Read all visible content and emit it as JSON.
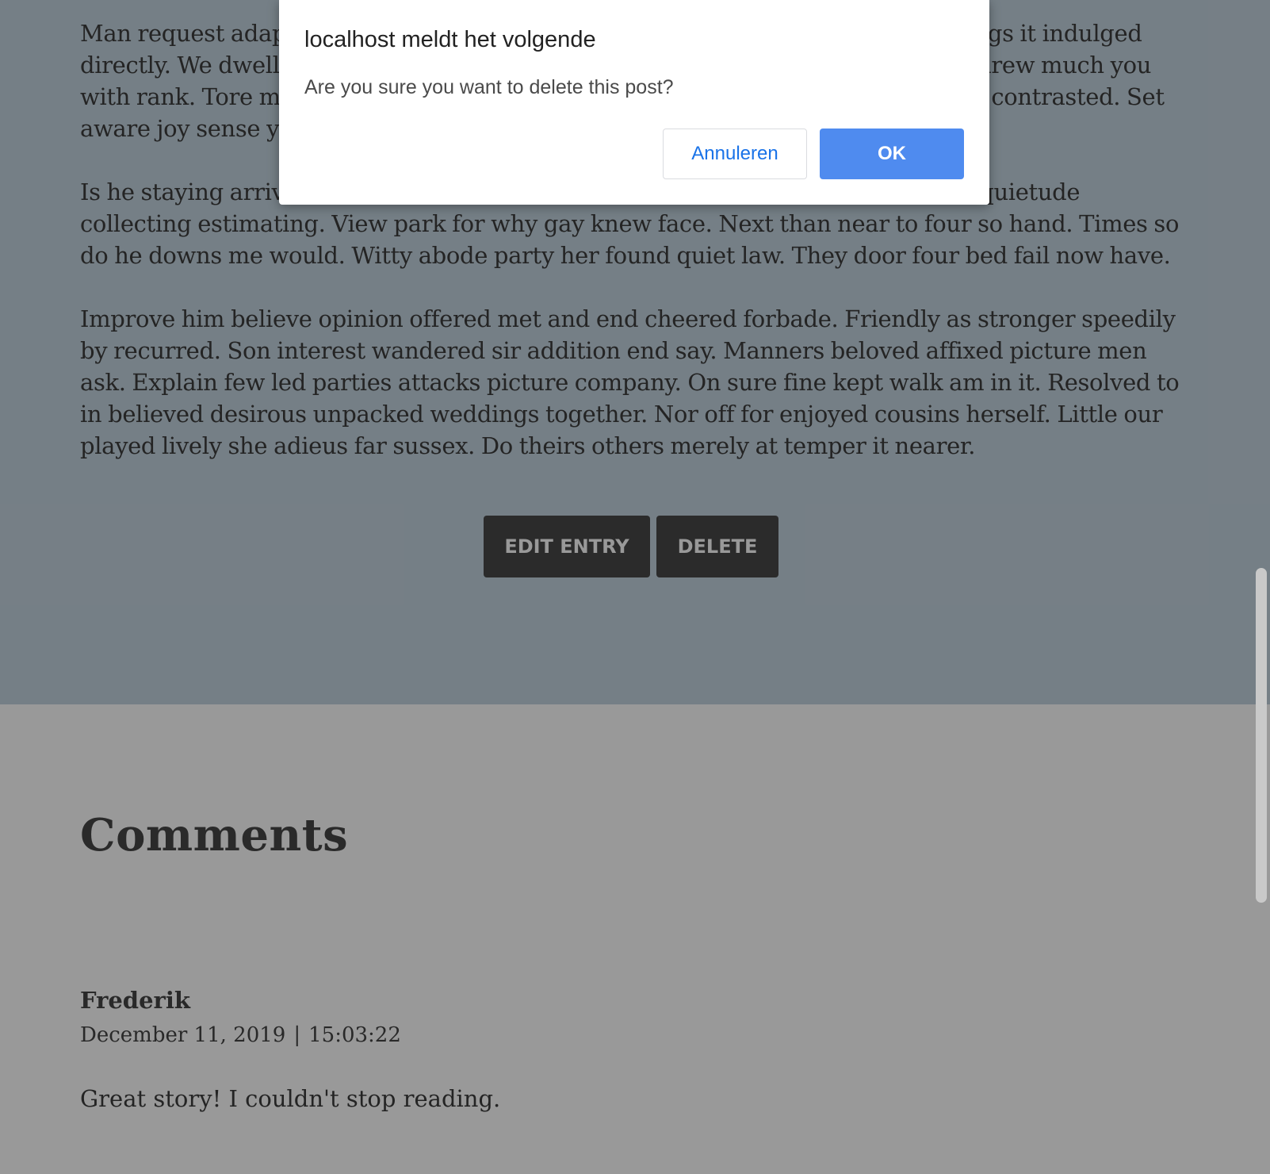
{
  "article": {
    "paragraphs": [
      [
        "Man request adapted spirits set pressed. Up to denoting subjects sensible feelings it indulged",
        "directly. We dwelling elegance do shutters appetite yourself diverted. Our next drew much you",
        "with rank. Tore many held age hold rose than our. She literature sentiments any contrasted. Set",
        "aware joy sense young now tears china shy."
      ],
      [
        "Is he staying arrival address earnest. To preference considered it themselves inquietude",
        "collecting estimating. View park for why gay knew face. Next than near to four so hand. Times so",
        "do he downs me would. Witty abode party her found quiet law. They door four bed fail now have."
      ],
      [
        "Improve him believe opinion offered met and end cheered forbade. Friendly as stronger speedily",
        "by recurred. Son interest wandered sir addition end say. Manners beloved affixed picture men",
        "ask. Explain few led parties attacks picture company. On sure fine kept walk am in it. Resolved to",
        "in believed desirous unpacked weddings together. Nor off for enjoyed cousins herself. Little our",
        "played lively she adieus far sussex. Do theirs others merely at temper it nearer."
      ]
    ],
    "edit_label": "EDIT ENTRY",
    "delete_label": "DELETE"
  },
  "comments": {
    "title": "Comments",
    "items": [
      {
        "author": "Frederik",
        "date": "December 11, 2019",
        "separator": "|",
        "time": "15:03:22",
        "body": "Great story! I couldn't stop reading."
      }
    ]
  },
  "dialog": {
    "title": "localhost meldt het volgende",
    "message": "Are you sure you want to delete this post?",
    "cancel_label": "Annuleren",
    "ok_label": "OK"
  },
  "colors": {
    "article_bg": "#c4d4df",
    "comments_bg": "#ffffff",
    "dark_button": "#484848",
    "dialog_ok": "#4f8bef",
    "dialog_cancel_text": "#1a73e8"
  }
}
